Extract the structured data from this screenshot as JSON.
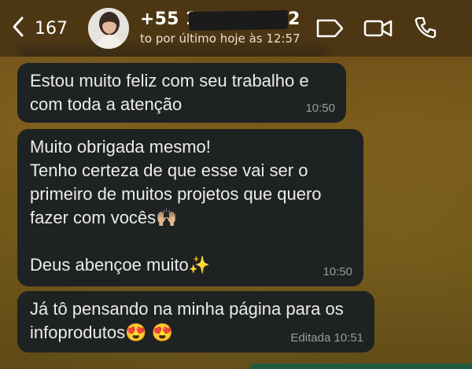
{
  "header": {
    "back_count": "167",
    "contact_name_start": "+55 1",
    "contact_name_end": "2",
    "last_seen": "to por último hoje às 12:57"
  },
  "messages": [
    {
      "text": "Estou muito feliz com seu trabalho e\ncom toda a atenção",
      "time": "10:50"
    },
    {
      "text": "Muito obrigada mesmo!\nTenho certeza de que esse vai ser o\nprimeiro de muitos projetos que quero\nfazer com vocês🙌🏼\n\nDeus abençoe muito✨",
      "time": "10:50"
    },
    {
      "text": "Já tô pensando na minha página para os\ninfoprodutos😍 😍",
      "time": "Editada 10:51"
    }
  ],
  "icons": {
    "back": "chevron-left",
    "status": "status-bubble",
    "video": "video-camera",
    "call": "phone"
  },
  "colors": {
    "incoming_bubble": "#1f2223",
    "text": "#ebebeb",
    "time": "#9a9a9a",
    "header": "#42301280"
  }
}
